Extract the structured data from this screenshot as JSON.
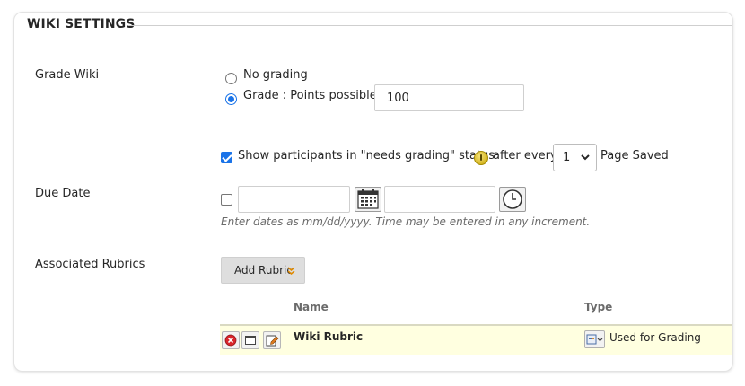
{
  "section": {
    "title": "WIKI SETTINGS"
  },
  "grade": {
    "label": "Grade Wiki",
    "option_no_grading": "No grading",
    "option_points": "Grade : Points possible :",
    "points_value": "100"
  },
  "needs_grading": {
    "text_before": "Show participants in \"needs grading\" status",
    "text_after": "after every",
    "select_value": "1",
    "text_end": "Page Saved",
    "checked": true
  },
  "due_date": {
    "label": "Due Date",
    "date_value": "",
    "time_value": "",
    "hint": "Enter dates as mm/dd/yyyy. Time may be entered in any increment."
  },
  "rubrics": {
    "label": "Associated Rubrics",
    "add_button": "Add Rubric",
    "columns": {
      "name": "Name",
      "type": "Type"
    },
    "rows": [
      {
        "name": "Wiki Rubric",
        "type": "Used for Grading"
      }
    ]
  },
  "icons": {
    "info": "info-icon",
    "calendar": "calendar-icon",
    "clock": "clock-icon",
    "remove": "remove-icon",
    "view": "view-icon",
    "edit": "edit-icon",
    "rubric_type": "rubric-type-icon"
  }
}
